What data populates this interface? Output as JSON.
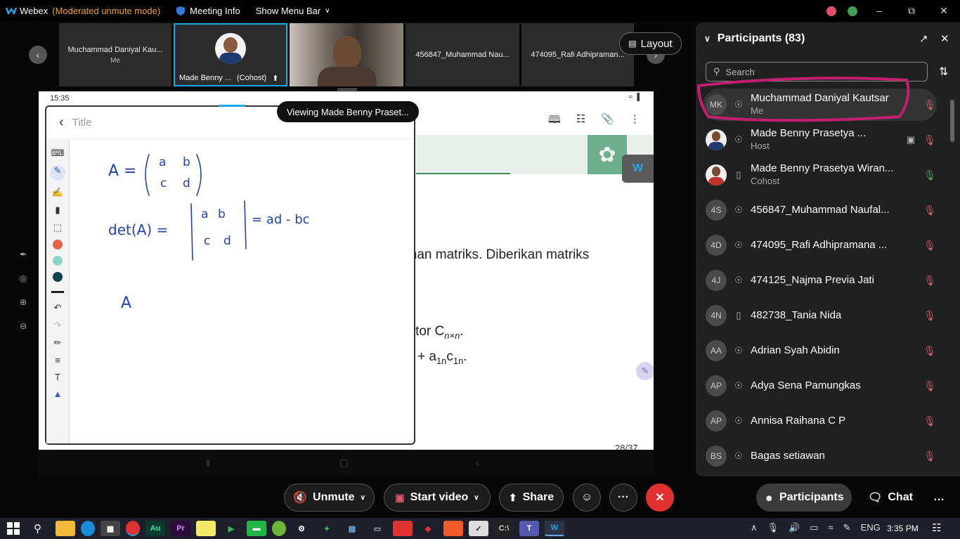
{
  "titlebar": {
    "app_name": "Webex",
    "mode_note": "(Moderated unmute mode)",
    "meeting_info": "Meeting Info",
    "show_menu_bar": "Show Menu Bar"
  },
  "video_strip": {
    "tiles": [
      {
        "name": "Muchammad Daniyal Kau...",
        "sub": "Me"
      },
      {
        "name": "Made Benny ...",
        "sub": "(Cohost)"
      },
      {
        "name": "",
        "sub": ""
      },
      {
        "name": "456847_Muhammad Nau...",
        "sub": ""
      },
      {
        "name": "474095_Rafi Adhipraman...",
        "sub": ""
      }
    ],
    "layout_label": "Layout"
  },
  "shared_screen": {
    "status_time": "15:35",
    "viewing_label": "Viewing Made Benny Praset...",
    "note_title_placeholder": "Title",
    "slide_text_1": "hinan matriks. Diberikan matriks",
    "slide_text_2": "aktor C",
    "slide_text_2_sub": "n×n",
    "slide_text_3": "+ a",
    "slide_text_3_sub": "1n",
    "slide_text_3_b": "c",
    "slide_text_3_sub_b": "1n",
    "page_counter": "28/37",
    "handwriting": {
      "line1": "A = ( a  b / c  d )",
      "line2": "det(A) = | a b / c d | = ad - bc",
      "line3": "A"
    },
    "pen_colors": [
      "#e8604c",
      "#8fd3c7",
      "#15404f"
    ]
  },
  "participants_panel": {
    "title": "Participants (83)",
    "search_placeholder": "Search",
    "rows": [
      {
        "initials": "MK",
        "name": "Muchammad Daniyal Kautsar",
        "role": "Me",
        "device": "headset"
      },
      {
        "initials": "",
        "name": "Made Benny Prasetya ...",
        "role": "Host",
        "device": "headset"
      },
      {
        "initials": "",
        "name": "Made Benny Prasetya Wiran...",
        "role": "Cohost",
        "device": "phone"
      },
      {
        "initials": "4S",
        "name": "456847_Muhammad Naufal...",
        "role": "",
        "device": "headset"
      },
      {
        "initials": "4D",
        "name": "474095_Rafi Adhipramana ...",
        "role": "",
        "device": "headset"
      },
      {
        "initials": "4J",
        "name": "474125_Najma Previa Jati",
        "role": "",
        "device": "headset"
      },
      {
        "initials": "4N",
        "name": "482738_Tania Nida",
        "role": "",
        "device": "phone"
      },
      {
        "initials": "AA",
        "name": "Adrian Syah Abidin",
        "role": "",
        "device": "headset"
      },
      {
        "initials": "AP",
        "name": "Adya Sena Pamungkas",
        "role": "",
        "device": "headset"
      },
      {
        "initials": "AP",
        "name": "Annisa Raihana C P",
        "role": "",
        "device": "headset"
      },
      {
        "initials": "BS",
        "name": "Bagas setiawan",
        "role": "",
        "device": "headset"
      }
    ]
  },
  "controls": {
    "unmute": "Unmute",
    "start_video": "Start video",
    "share": "Share",
    "more": "···",
    "participants": "Participants",
    "chat": "Chat"
  },
  "taskbar": {
    "language": "ENG",
    "time": "3:35 PM"
  },
  "colors": {
    "accent_cyan": "#1aa6e8",
    "leave_red": "#e0302f",
    "mute_red": "#e05b6c",
    "annotation_magenta": "#c0206d",
    "mod_orange": "#f0a33c"
  }
}
